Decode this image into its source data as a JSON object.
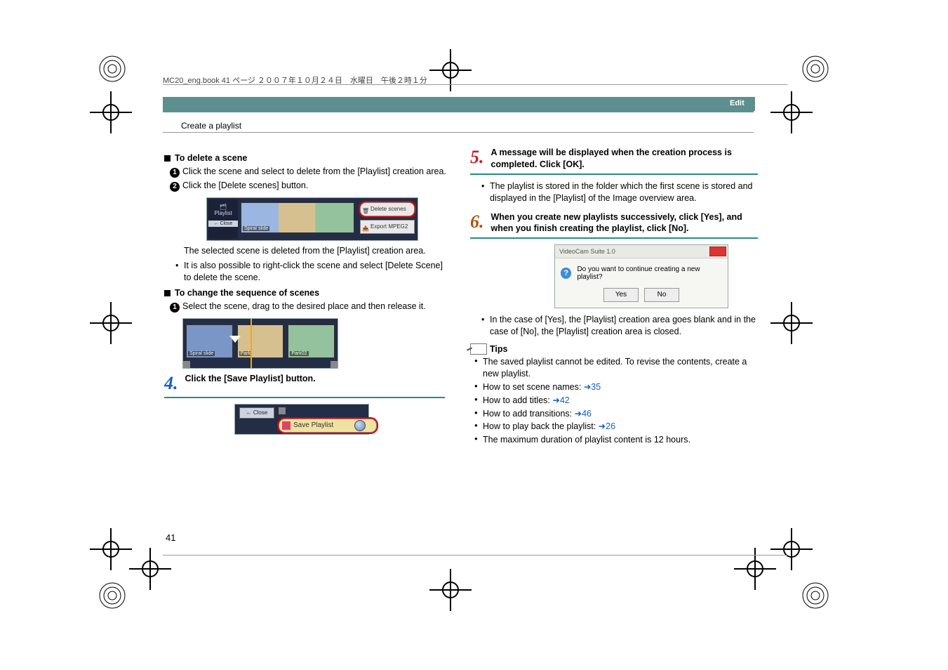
{
  "header_file_line": "MC20_eng.book  41 ページ  ２００７年１０月２４日　水曜日　午後２時１分",
  "tab": "Edit",
  "breadcrumb": "Create a playlist",
  "page_number": "41",
  "left": {
    "h1": "To delete a scene",
    "s1": "Click the scene and select to delete from the [Playlist] creation area.",
    "s2": "Click the [Delete scenes] button.",
    "fig_a": {
      "panel_line1": "Playlist",
      "panel_close": "← Close",
      "thumb_label": "Spiral slide",
      "btn_delete": "Delete scenes",
      "btn_export": "Export MPEG2"
    },
    "after_a_1": "The selected scene is deleted from the [Playlist] creation area.",
    "after_a_bullet": "It is also possible to right-click the scene and select [Delete Scene] to delete the scene.",
    "h2": "To change the sequence of scenes",
    "s3": "Select the scene, drag to the desired place and then release it.",
    "fig_b": {
      "l1": "Spiral slide",
      "l2": "Park",
      "l3": "Park02"
    },
    "step4_num": "4.",
    "step4_txt": "Click the [Save Playlist] button.",
    "fig_c": {
      "close": "← Close",
      "save": "Save Playlist"
    }
  },
  "right": {
    "step5_num": "5.",
    "step5_txt": "A message will be displayed when the creation process is completed. Click [OK].",
    "step5_bullet": "The playlist is stored in the folder which the first scene is stored and displayed in the [Playlist] of the Image overview area.",
    "step6_num": "6.",
    "step6_txt": "When you create new playlists successively, click [Yes], and when you finish creating the playlist, click [No].",
    "dialog": {
      "title": "VideoCam Suite 1.0",
      "msg": "Do you want to continue creating a new playlist?",
      "yes": "Yes",
      "no": "No"
    },
    "step6_bullet": "In the case of [Yes], the [Playlist] creation area goes blank and in the case of [No], the [Playlist] creation area is closed.",
    "tips_label": "Tips",
    "tips": {
      "t1": "The saved playlist cannot be edited. To revise the contents, create a new playlist.",
      "t2a": "How to set scene names: ",
      "t2l": "➜35",
      "t3a": "How to add titles: ",
      "t3l": "➜42",
      "t4a": "How to add transitions: ",
      "t4l": "➜46",
      "t5a": "How to play back the playlist: ",
      "t5l": "➜26",
      "t6": "The maximum duration of playlist content is 12 hours."
    }
  }
}
